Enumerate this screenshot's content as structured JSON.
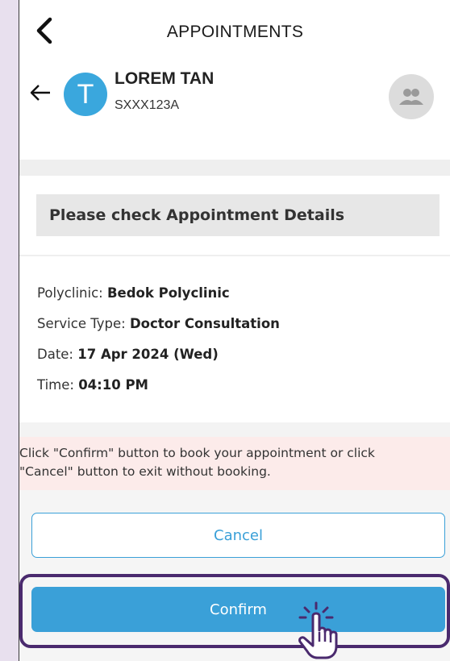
{
  "header": {
    "title": "APPOINTMENTS"
  },
  "profile": {
    "avatar_letter": "T",
    "name": "LOREM TAN",
    "id": "SXXX123A"
  },
  "details": {
    "heading": "Please check Appointment Details",
    "polyclinic_label": "Polyclinic: ",
    "polyclinic_value": "Bedok Polyclinic",
    "service_label": "Service Type: ",
    "service_value": "Doctor Consultation",
    "date_label": "Date: ",
    "date_value": "17 Apr 2024 (Wed)",
    "time_label": "Time: ",
    "time_value": "04:10 PM"
  },
  "notice": {
    "line1": "Click \"Confirm\" button to book your appointment or click",
    "line2": "\"Cancel\" button to exit without booking."
  },
  "buttons": {
    "cancel_label": "Cancel",
    "confirm_label": "Confirm"
  },
  "colors": {
    "accent": "#3aa0d8",
    "avatar": "#3aa7dd",
    "notice_bg": "#fcebea",
    "highlight": "#4a2a6e",
    "page_bg": "#e8e0ee"
  },
  "icons": [
    "chevron-left-icon",
    "arrow-left-icon",
    "group-icon",
    "tap-hand-icon"
  ]
}
